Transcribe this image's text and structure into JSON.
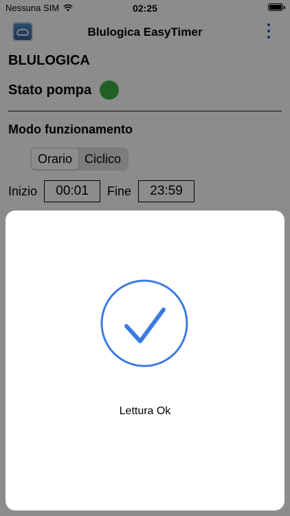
{
  "status_bar": {
    "carrier": "Nessuna SIM",
    "time": "02:25",
    "wifi_icon": "wifi-icon",
    "battery_icon": "battery-icon"
  },
  "nav": {
    "title": "Blulogica EasyTimer",
    "app_icon": "app-logo-icon",
    "menu_icon": "more-vertical-icon",
    "accent_color": "#1a55c9"
  },
  "content": {
    "company": "BLULOGICA",
    "pump_status_label": "Stato pompa",
    "pump_status_color": "#3cb043",
    "mode_title": "Modo funzionamento",
    "modes": [
      {
        "label": "Orario",
        "selected": true
      },
      {
        "label": "Ciclico",
        "selected": false
      }
    ],
    "start_label": "Inizio",
    "start_time": "00:01",
    "end_label": "Fine",
    "end_time": "23:59"
  },
  "dialog": {
    "icon": "checkmark-circle-icon",
    "icon_color": "#3a7be0",
    "message": "Lettura Ok"
  }
}
